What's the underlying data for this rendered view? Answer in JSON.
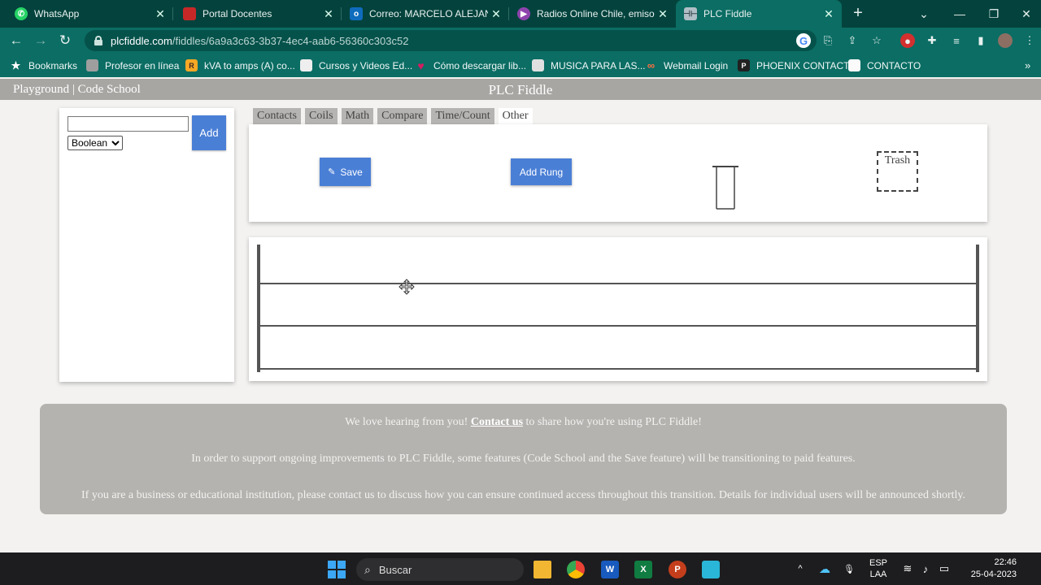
{
  "browser": {
    "tabs": [
      {
        "title": "WhatsApp",
        "icon": "whatsapp-icon",
        "color": "#25d366"
      },
      {
        "title": "Portal Docentes",
        "icon": "portal-icon",
        "color": "#c62828"
      },
      {
        "title": "Correo: MARCELO ALEJANDR",
        "icon": "outlook-icon",
        "color": "#0f6cbd"
      },
      {
        "title": "Radios Online Chile, emisoras",
        "icon": "radio-icon",
        "color": "#8e44ad"
      },
      {
        "title": "PLC Fiddle",
        "icon": "plcfiddle-icon",
        "color": "#607d8b"
      }
    ],
    "url_host": "plcfiddle.com",
    "url_path": "/fiddles/6a9a3c63-3b37-4ec4-aab6-56360c303c52",
    "bookmarks": [
      {
        "label": "Bookmarks",
        "icon": "star-icon"
      },
      {
        "label": "Profesor en línea",
        "icon": "profesor-icon"
      },
      {
        "label": "kVA to amps (A) co...",
        "icon": "rapidtables-icon"
      },
      {
        "label": "Cursos y Videos Ed...",
        "icon": "cursos-icon"
      },
      {
        "label": "Cómo descargar lib...",
        "icon": "heart-icon"
      },
      {
        "label": "MUSICA PARA LAS...",
        "icon": "musica-icon"
      },
      {
        "label": "Webmail Login",
        "icon": "webmail-icon"
      },
      {
        "label": "PHOENIX CONTACT",
        "icon": "phoenix-icon"
      },
      {
        "label": "CONTACTO",
        "icon": "contacto-icon"
      }
    ]
  },
  "app": {
    "nav_left": "Playground | Code School",
    "title": "PLC Fiddle",
    "tag_input_value": "",
    "type_select": "Boolean",
    "add_label": "Add",
    "tabs": [
      "Contacts",
      "Coils",
      "Math",
      "Compare",
      "Time/Count",
      "Other"
    ],
    "active_tab": "Other",
    "save_label": "Save",
    "add_rung_label": "Add Rung",
    "trash_label": "Trash",
    "banner": {
      "line1_before": "We love hearing from you!",
      "line1_link": "Contact us",
      "line1_after": "to share how you're using PLC Fiddle!",
      "line2": "In order to support ongoing improvements to PLC Fiddle, some features (Code School and the Save feature) will be transitioning to paid features.",
      "line3": "If you are a business or educational institution, please contact us to discuss how you can ensure continued access throughout this transition. Details for individual users will be announced shortly."
    }
  },
  "taskbar": {
    "search_label": "Buscar",
    "lang_top": "ESP",
    "lang_bottom": "LAA",
    "time": "22:46",
    "date": "25-04-2023"
  },
  "colors": {
    "chrome_frame": "#04433d",
    "chrome_toolbar": "#0b6d64",
    "button_blue": "#4a7fd6",
    "header_gray": "#a8a6a3"
  }
}
